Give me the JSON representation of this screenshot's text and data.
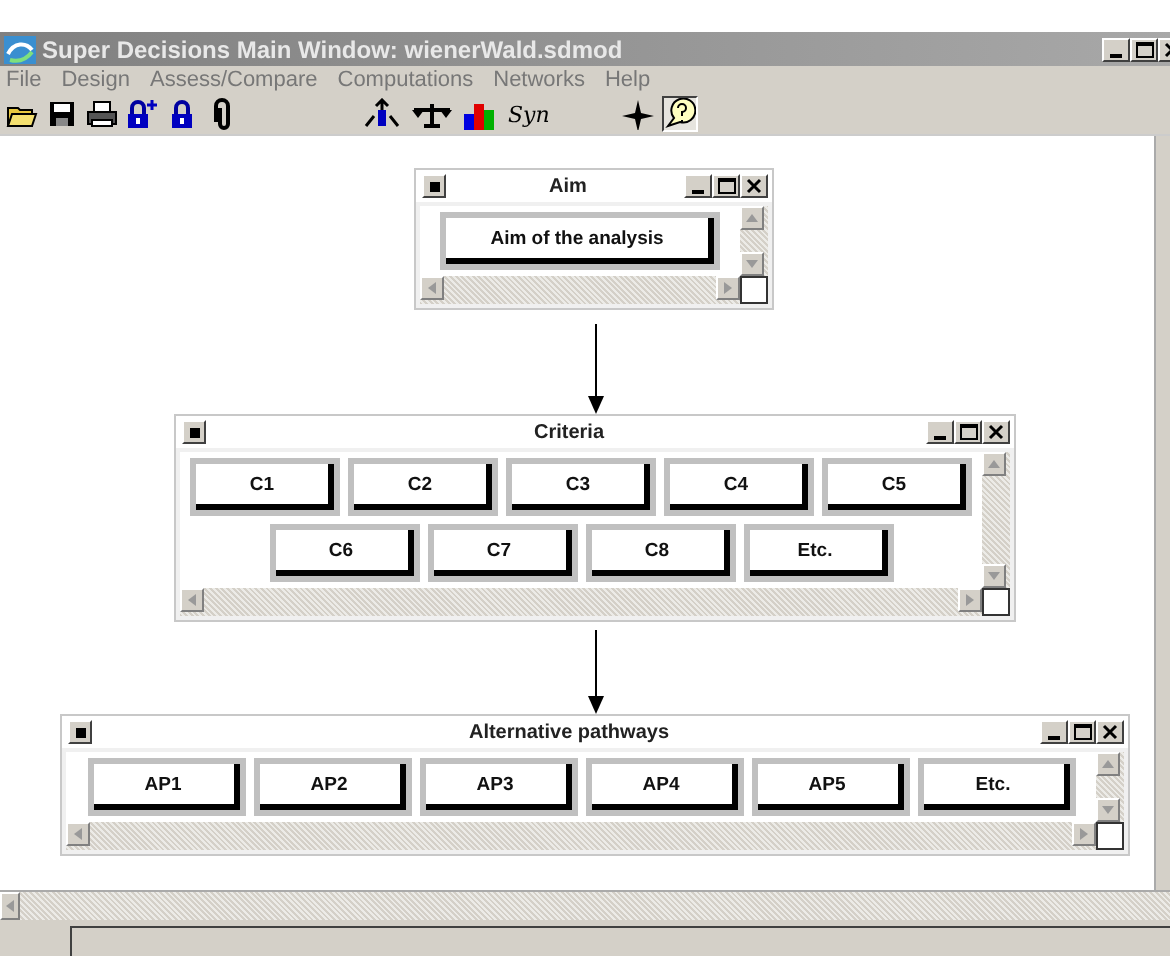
{
  "window": {
    "title": "Super Decisions Main Window: wienerWald.sdmod"
  },
  "menu": [
    "File",
    "Design",
    "Assess/Compare",
    "Computations",
    "Networks",
    "Help"
  ],
  "toolbar": [
    {
      "kind": "open"
    },
    {
      "kind": "save"
    },
    {
      "kind": "print"
    },
    {
      "kind": "lock-plus"
    },
    {
      "kind": "lock"
    },
    {
      "kind": "clip"
    },
    {
      "kind": "network"
    },
    {
      "kind": "balance"
    },
    {
      "kind": "bars"
    },
    {
      "kind": "text",
      "label": "Syn"
    },
    {
      "kind": "star"
    },
    {
      "kind": "help",
      "selected": true
    }
  ],
  "nodes": [
    {
      "title": "Aim",
      "elements": [
        "Aim of the analysis"
      ]
    },
    {
      "title": "Criteria",
      "elements": [
        "C1",
        "C2",
        "C3",
        "C4",
        "C5",
        "C6",
        "C7",
        "C8",
        "Etc."
      ]
    },
    {
      "title": "Alternative pathways",
      "elements": [
        "AP1",
        "AP2",
        "AP3",
        "AP4",
        "AP5",
        "Etc."
      ]
    }
  ]
}
